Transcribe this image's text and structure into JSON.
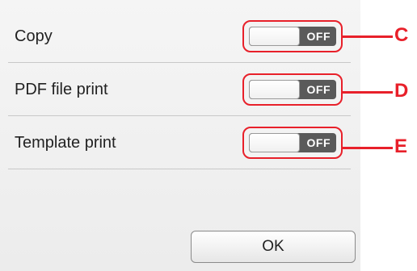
{
  "settings": [
    {
      "label": "Copy",
      "state": "OFF",
      "callout": "C"
    },
    {
      "label": "PDF file print",
      "state": "OFF",
      "callout": "D"
    },
    {
      "label": "Template print",
      "state": "OFF",
      "callout": "E"
    }
  ],
  "ok_button": {
    "label": "OK"
  },
  "colors": {
    "accent": "#e8202a",
    "toggle_track": "#5a5a5a"
  }
}
